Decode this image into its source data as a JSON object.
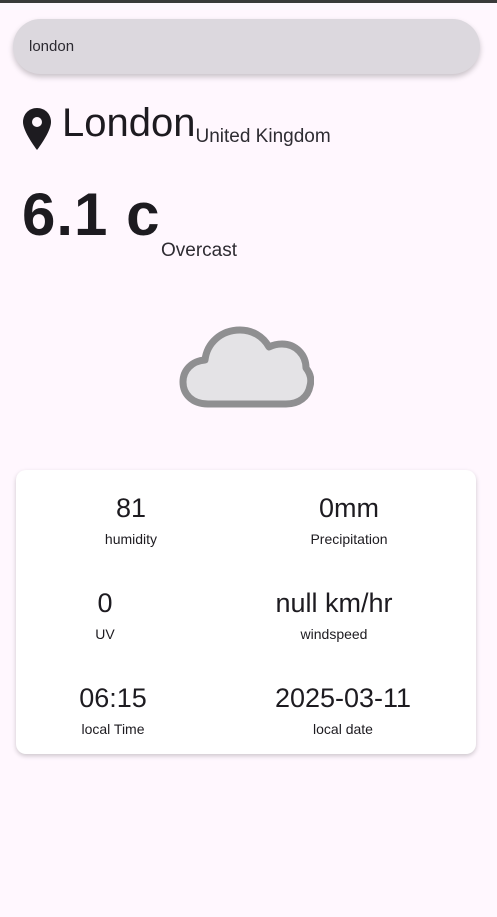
{
  "search": {
    "value": "london"
  },
  "location": {
    "icon": "location-pin-icon",
    "city": "London",
    "country": "United Kingdom"
  },
  "weather": {
    "temperature": "6.1 c",
    "condition": "Overcast",
    "icon": "cloud-icon"
  },
  "details": [
    {
      "value": "81",
      "label": "humidity"
    },
    {
      "value": "0mm",
      "label": "Precipitation"
    },
    {
      "value": "0",
      "label": "UV"
    },
    {
      "value": "null km/hr",
      "label": "windspeed"
    },
    {
      "value": "06:15",
      "label": "local Time"
    },
    {
      "value": "2025-03-11",
      "label": "local date"
    }
  ]
}
